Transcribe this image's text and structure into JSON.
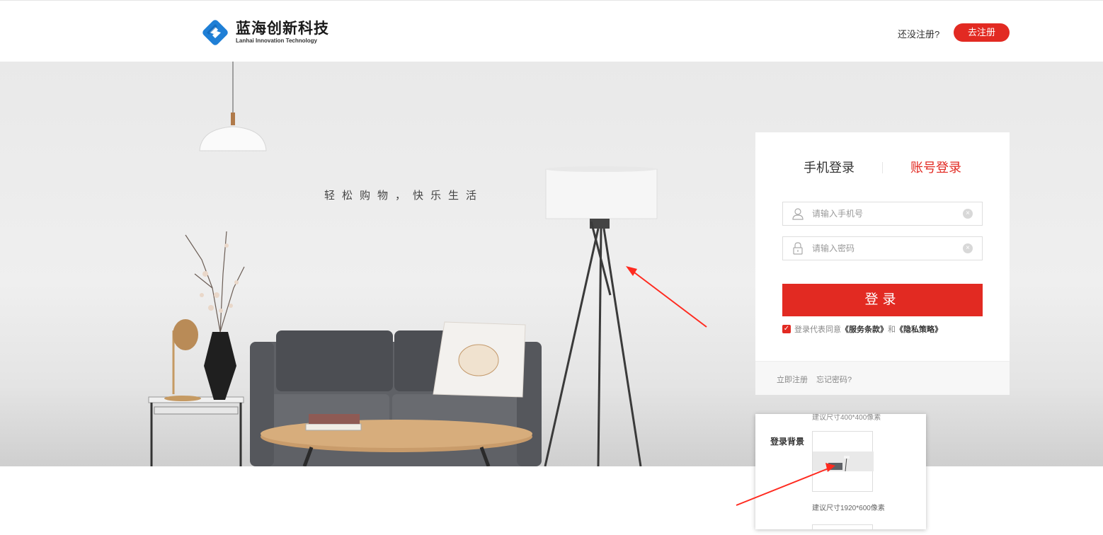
{
  "header": {
    "logo_cn": "蓝海创新科技",
    "logo_en": "Lanhai Innovation Technology",
    "register_prompt": "还没注册?",
    "register_button": "去注册"
  },
  "hero": {
    "tagline": "轻松购物，快乐生活"
  },
  "login": {
    "tabs": [
      {
        "label": "手机登录",
        "active": false
      },
      {
        "label": "账号登录",
        "active": true
      }
    ],
    "phone_placeholder": "请输入手机号",
    "password_placeholder": "请输入密码",
    "login_button": "登录",
    "agree_text": "登录代表同意",
    "terms_link": "《服务条款》",
    "and_text": "和",
    "privacy_link": "《隐私策略》",
    "footer_register": "立即注册",
    "footer_forgot": "忘记密码?"
  },
  "popup": {
    "cut_text": "建议尺寸400*400像素",
    "label": "登录背景",
    "hint": "建议尺寸1920*600像素"
  },
  "colors": {
    "accent": "#e22a22",
    "hero_bg": "#ececec"
  }
}
